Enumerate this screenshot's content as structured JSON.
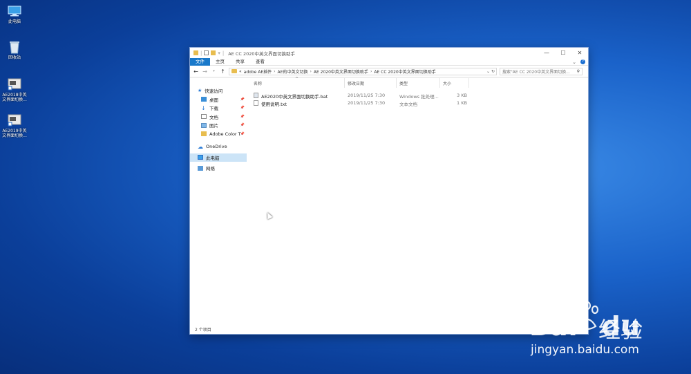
{
  "desktop": {
    "icons": [
      {
        "label": "此电脑",
        "icon": "computer-icon"
      },
      {
        "label": "回收站",
        "icon": "recycle-bin-icon"
      },
      {
        "label": "AE2018中英文界面切换...",
        "icon": "shortcut-icon"
      },
      {
        "label": "AE2019中英文界面切换...",
        "icon": "shortcut-icon"
      }
    ]
  },
  "window": {
    "title": "AE CC 2020中英文界面切换助手",
    "controls": {
      "minimize": "—",
      "maximize": "☐",
      "close": "✕"
    }
  },
  "ribbon": {
    "tabs": [
      "文件",
      "主页",
      "共享",
      "查看"
    ],
    "expand": "⌄",
    "help": "?"
  },
  "address": {
    "prefix": "«",
    "crumbs": [
      "adobe AE插件",
      "AE的中英文切换",
      "AE 2020中英文界面切换助手",
      "AE CC 2020中英文界面切换助手"
    ],
    "search_placeholder": "搜索\"AE CC 2020中英文界面切换..."
  },
  "nav": {
    "quick_access": "快速访问",
    "quick_items": [
      {
        "label": "桌面",
        "icon": "desktop-folder-icon"
      },
      {
        "label": "下载",
        "icon": "download-icon"
      },
      {
        "label": "文档",
        "icon": "documents-icon"
      },
      {
        "label": "图片",
        "icon": "pictures-icon"
      },
      {
        "label": "Adobe Color T",
        "icon": "folder-icon"
      }
    ],
    "onedrive": "OneDrive",
    "this_pc": "此电脑",
    "network": "网络"
  },
  "columns": {
    "name": "名称",
    "date": "修改日期",
    "type": "类型",
    "size": "大小"
  },
  "files": [
    {
      "name": "AE2020中英文界面切换助手.bat",
      "date": "2019/11/25 7:30",
      "type": "Windows 批处理...",
      "size": "3 KB"
    },
    {
      "name": "使用说明.txt",
      "date": "2019/11/25 7:30",
      "type": "文本文档",
      "size": "1 KB"
    }
  ],
  "status": {
    "count": "2 个项目"
  },
  "watermark": {
    "brand": "Bai",
    "brand2": "du",
    "product": "经验",
    "url": "jingyan.baidu.com"
  },
  "colors": {
    "accent": "#1979ca",
    "selected": "#cce4f7",
    "folder": "#e8bd4f"
  }
}
